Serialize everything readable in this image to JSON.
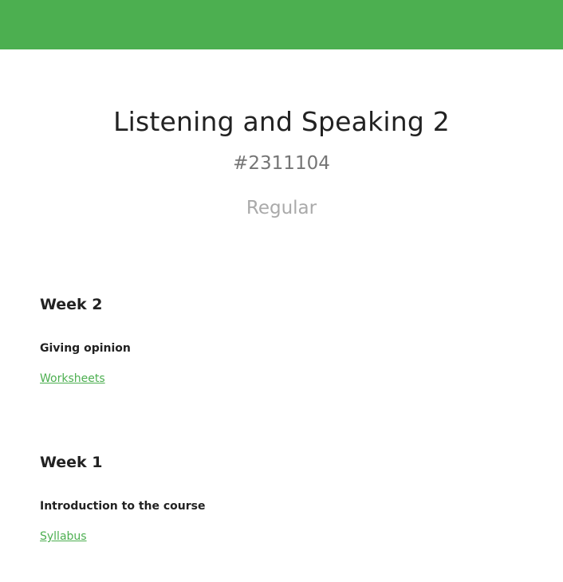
{
  "header": {
    "title": "Listening and Speaking 2",
    "code": "#2311104",
    "type": "Regular"
  },
  "weeks": [
    {
      "title": "Week 2",
      "lesson": "Giving opinion",
      "link": "Worksheets"
    },
    {
      "title": "Week 1",
      "lesson": "Introduction to the course",
      "link": "Syllabus"
    }
  ],
  "colors": {
    "accent": "#4caf50"
  }
}
